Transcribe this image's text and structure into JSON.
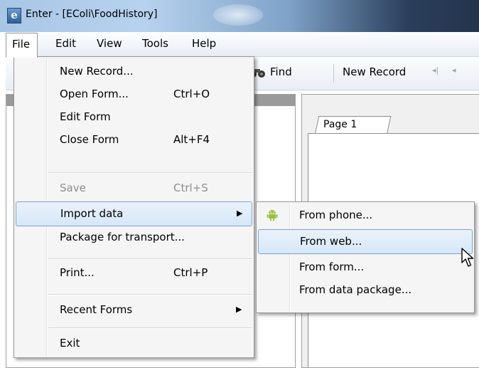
{
  "window": {
    "title": "Enter - [EColi\\FoodHistory]",
    "app_icon_letter": "e"
  },
  "menubar": {
    "items": [
      "File",
      "Edit",
      "View",
      "Tools",
      "Help"
    ]
  },
  "toolbar": {
    "find_label": "Find",
    "new_record_label": "New Record",
    "nav_first": "◂|",
    "nav_prev": "◂"
  },
  "page_tabs": {
    "tab1": "Page 1"
  },
  "file_menu": {
    "items": [
      {
        "label": "New Record...",
        "shortcut": ""
      },
      {
        "label": "Open Form...",
        "shortcut": "Ctrl+O"
      },
      {
        "label": "Edit Form",
        "shortcut": ""
      },
      {
        "label": "Close Form",
        "shortcut": "Alt+F4"
      },
      {
        "label": "Save",
        "shortcut": "Ctrl+S",
        "disabled": true
      },
      {
        "label": "Import data",
        "submenu": true,
        "highlighted": true
      },
      {
        "label": "Package for transport...",
        "shortcut": ""
      },
      {
        "label": "Print...",
        "shortcut": "Ctrl+P"
      },
      {
        "label": "Recent Forms",
        "submenu": true
      },
      {
        "label": "Exit",
        "shortcut": ""
      }
    ]
  },
  "import_submenu": {
    "items": [
      {
        "label": "From phone...",
        "icon": "android-icon"
      },
      {
        "label": "From web...",
        "highlighted": true
      },
      {
        "label": "From form..."
      },
      {
        "label": "From data package..."
      }
    ]
  },
  "colors": {
    "highlight_border": "#7da2ce",
    "menu_bg": "#f5f5f5",
    "android_green": "#9ac13b"
  }
}
